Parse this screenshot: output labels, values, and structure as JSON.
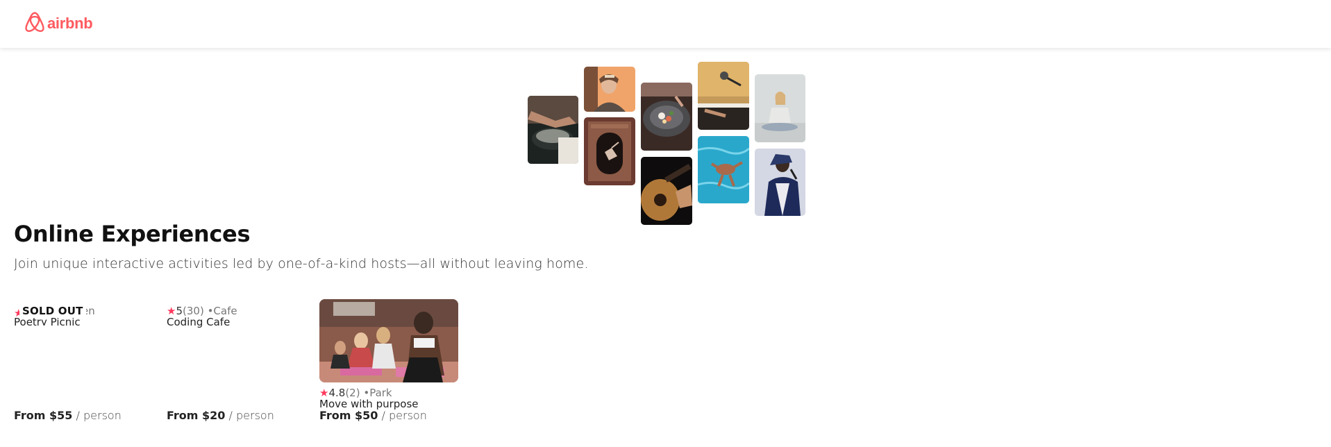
{
  "header": {
    "logo_text": "airbnb",
    "logo_icon": "airbnb-belo-icon",
    "brand_color": "#ff5a5f"
  },
  "collage": {
    "images": [
      "cooking-hands-photo",
      "woman-smiling-photo",
      "dancer-doorway-photo",
      "food-bowl-photo",
      "guitar-photo",
      "microphone-piano-photo",
      "swimmer-pool-photo",
      "meditation-photo",
      "singer-photo"
    ]
  },
  "hero": {
    "title": "Online Experiences",
    "subtitle": "Join unique interactive activities led by one-of-a-kind hosts—all without leaving home."
  },
  "cards": [
    {
      "badge": "SOLD OUT",
      "rating_partial": "en",
      "name": "Poetry Picnic",
      "price_label": "From $55",
      "per": "/ person"
    },
    {
      "star": "★",
      "rating": "5",
      "count": "(30)",
      "category": "•Cafe",
      "name": "Coding Cafe",
      "price_label": "From $20",
      "per": "/ person"
    },
    {
      "image": "yoga-class-photo",
      "star": "★",
      "rating": "4.8",
      "count": "(2)",
      "category": "•Park",
      "name": "Move with purpose",
      "price_label": "From $50",
      "per": "/ person"
    }
  ],
  "colors": {
    "accent_star": "#ff385c",
    "text_primary": "#222222"
  }
}
